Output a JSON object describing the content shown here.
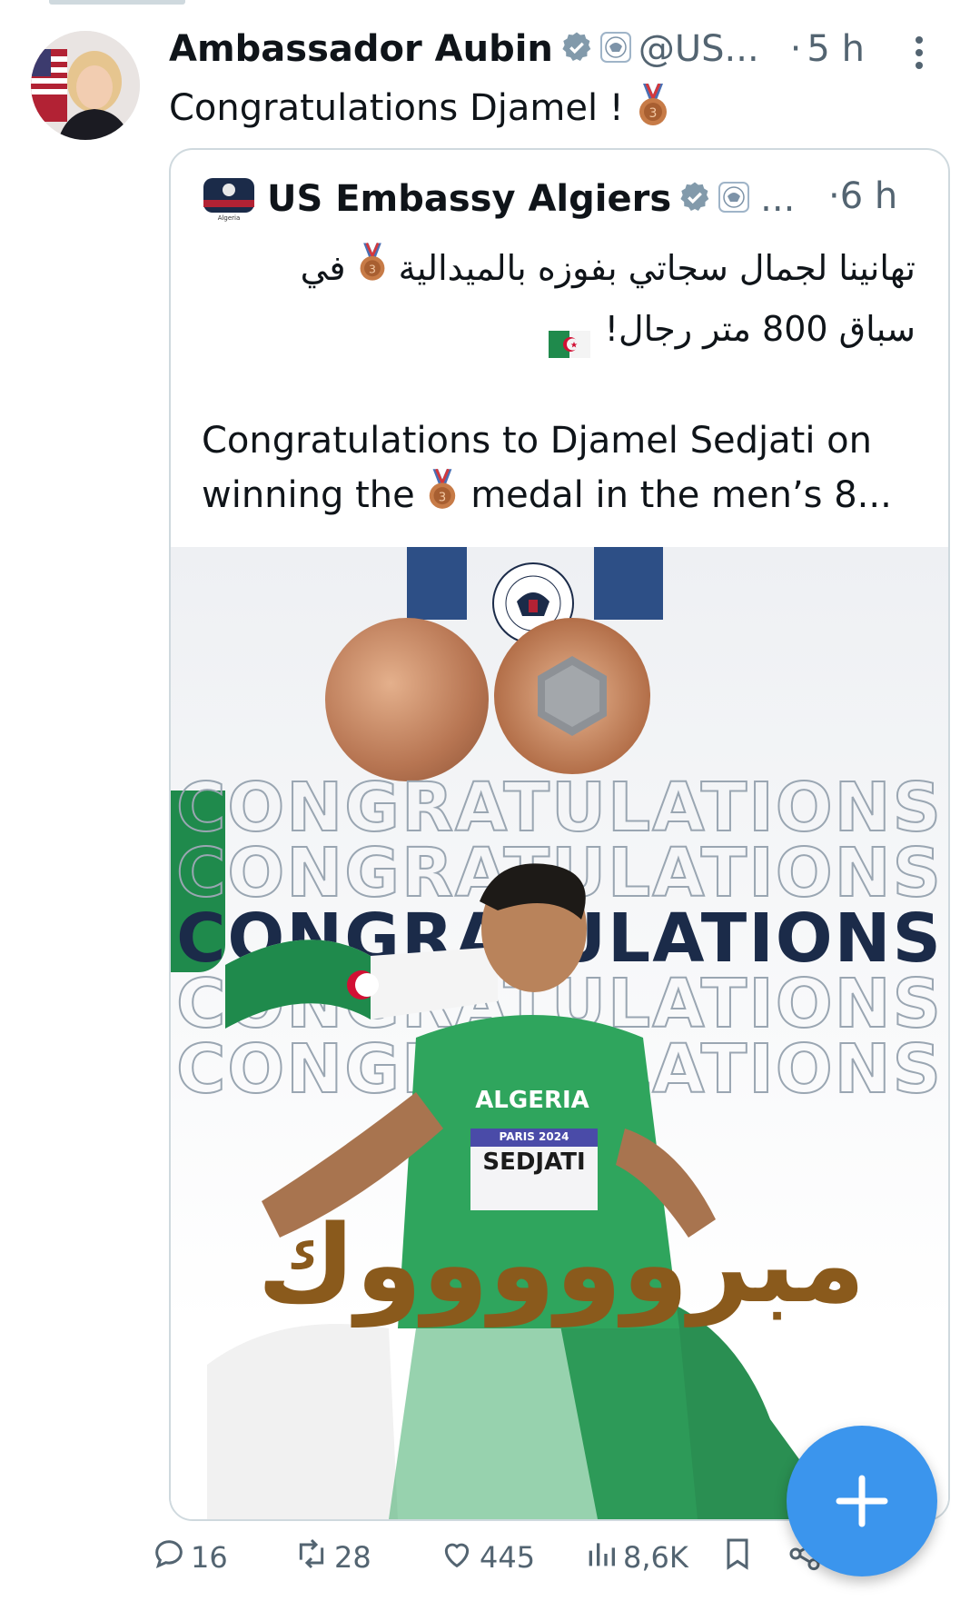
{
  "tweet": {
    "author_name": "Ambassador Aubin",
    "handle": "@US...",
    "time": "5 h",
    "text": "Congratulations Djamel !"
  },
  "quote": {
    "author_name": "US Embassy Algiers",
    "handle_truncated": "...",
    "time": "6 h",
    "arabic_line1": "تهانينا لجمال سجاتي بفوزه بالميدالية",
    "arabic_line1_end": "في",
    "arabic_line2": "سباق 800 متر رجال!",
    "english_line1": "Congratulations to Djamel Sedjati on",
    "english_line2_a": "winning the",
    "english_line2_b": "medal in the men’s 8..."
  },
  "image": {
    "congrats_word": "CONGRATULATIONS",
    "arabic_banner": "مبروووووك",
    "jersey_text": "ALGERIA",
    "bib_top": "PARIS 2024",
    "bib_name": "SEDJATI",
    "seal_text": "UNITED STATES EMBASSY ALGIERS"
  },
  "actions": {
    "replies": "16",
    "reposts": "28",
    "likes": "445",
    "views": "8,6K"
  },
  "colors": {
    "accent": "#1d9bf0",
    "fab": "#3b95ed",
    "bronze": "#c77b47",
    "banner": "#8a5a1c",
    "algeria_green": "#1f8a4c",
    "algeria_red": "#d21034"
  },
  "icons": [
    "verified-badge-icon",
    "us-seal-icon",
    "more-vertical-icon",
    "bronze-medal-icon",
    "algeria-flag-icon",
    "reply-icon",
    "repost-icon",
    "like-icon",
    "views-icon",
    "bookmark-icon",
    "share-icon",
    "plus-icon"
  ]
}
